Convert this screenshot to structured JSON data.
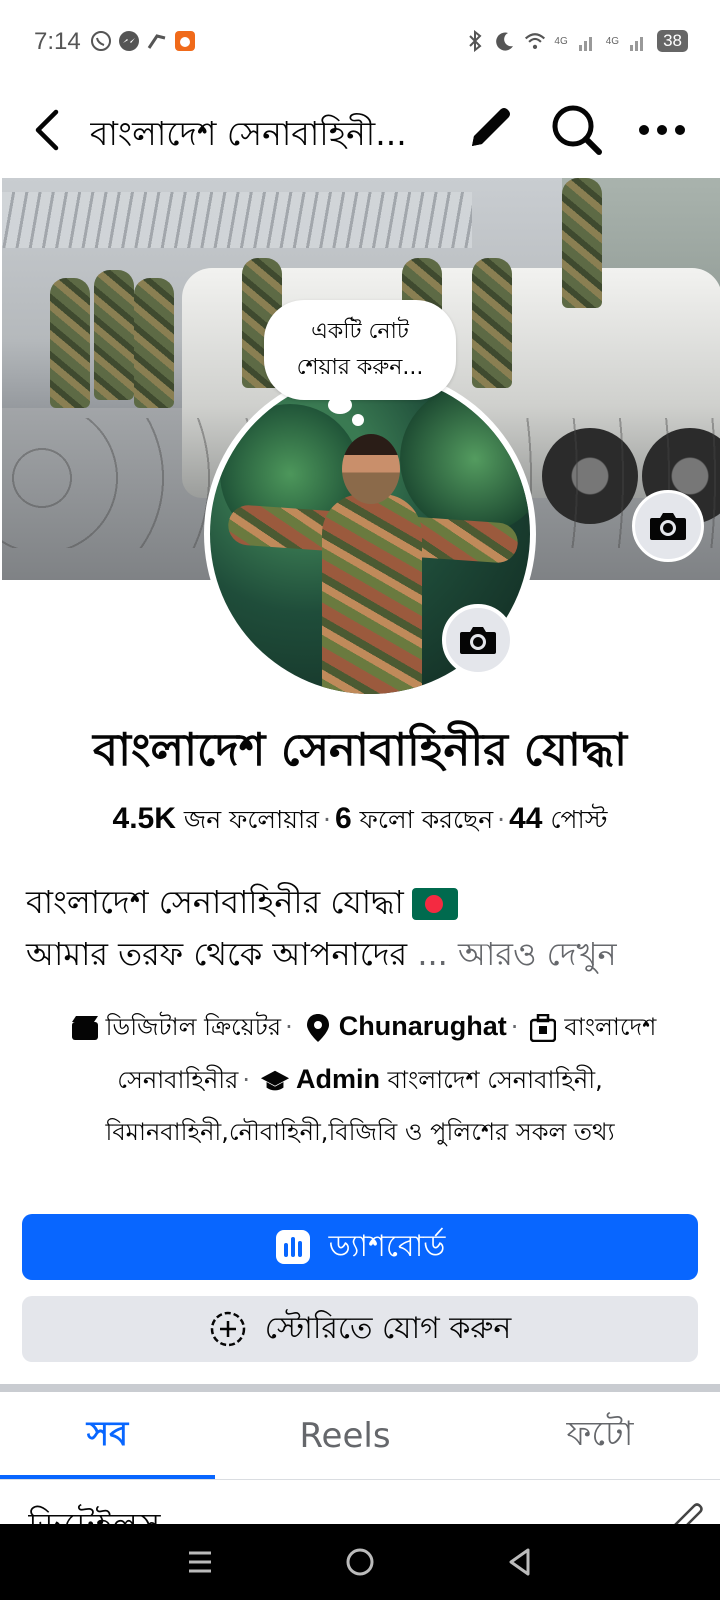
{
  "status_bar": {
    "time": "7:14",
    "network_1": "4G",
    "network_2": "4G",
    "battery": "38"
  },
  "top_bar": {
    "title": "বাংলাদেশ সেনাবাহিনী..."
  },
  "note": {
    "line1": "একটি নোট",
    "line2": "শেয়ার করুন..."
  },
  "profile": {
    "name": "বাংলাদেশ সেনাবাহিনীর যোদ্ধা",
    "followers_count": "4.5K",
    "followers_label": "জন ফলোয়ার",
    "following_count": "6",
    "following_label": "ফলো করছেন",
    "posts_count": "44",
    "posts_label": "পোস্ট",
    "separator": "·"
  },
  "bio": {
    "line1": "বাংলাদেশ সেনাবাহিনীর যোদ্ধা",
    "line2": "আমার তরফ থেকে আপনাদের",
    "ellipsis": "...",
    "see_more": "আরও দেখুন"
  },
  "details": {
    "category": "ডিজিটাল ক্রিয়েটর",
    "location": "Chunarughat",
    "work": "বাংলাদেশ সেনাবাহিনীর",
    "education_bold": "Admin",
    "education_rest": "বাংলাদেশ সেনাবাহিনী, বিমানবাহিনী,নৌবাহিনী,বিজিবি ও পুলিশের সকল তথ্য"
  },
  "actions": {
    "dashboard": "ড্যাশবোর্ড",
    "add_story": "স্টোরিতে যোগ করুন"
  },
  "tabs": [
    {
      "label": "সব",
      "active": true
    },
    {
      "label": "Reels",
      "active": false
    },
    {
      "label": "ফটো",
      "active": false
    }
  ],
  "peek": {
    "text": "ডিটেইলস"
  },
  "colors": {
    "accent": "#0866ff",
    "secondary_button": "#e4e6eb",
    "muted_text": "#65676b"
  },
  "icons": [
    "back-arrow-icon",
    "pencil-icon",
    "search-icon",
    "more-icon",
    "camera-icon",
    "clapperboard-icon",
    "location-pin-icon",
    "briefcase-icon",
    "graduation-cap-icon",
    "bar-chart-icon",
    "add-circle-icon"
  ]
}
